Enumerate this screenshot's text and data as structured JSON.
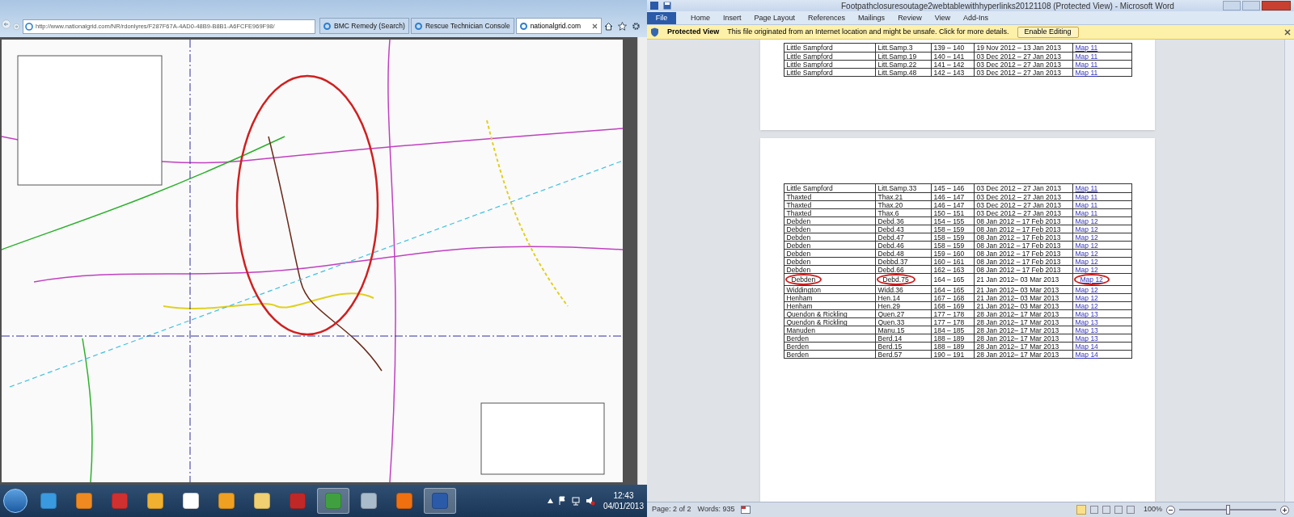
{
  "browser": {
    "address": "http://www.nationalgrid.com/NR/rdonlyres/F287F67A-4AD0-48B9-B8B1-A6FCFE969F98/",
    "tabs": [
      {
        "label": "BMC Remedy (Search)",
        "selected": false
      },
      {
        "label": "Rescue Technician Console",
        "selected": false
      },
      {
        "label": "nationalgrid.com",
        "selected": true
      }
    ]
  },
  "word": {
    "title": "Footpathclosuresoutage2webtablewithhyperlinks20121108 (Protected View)  -  Microsoft Word",
    "ribbon_tabs": [
      {
        "label": "File",
        "kind": "backstage"
      },
      {
        "label": "Home",
        "kind": "tab"
      },
      {
        "label": "Insert",
        "kind": "tab"
      },
      {
        "label": "Page Layout",
        "kind": "tab"
      },
      {
        "label": "References",
        "kind": "tab"
      },
      {
        "label": "Mailings",
        "kind": "tab"
      },
      {
        "label": "Review",
        "kind": "tab"
      },
      {
        "label": "View",
        "kind": "tab"
      },
      {
        "label": "Add-Ins",
        "kind": "tab"
      }
    ],
    "protected_view": {
      "title": "Protected View",
      "message": "This file originated from an Internet location and might be unsafe. Click for more details.",
      "button": "Enable Editing"
    },
    "pages": [
      {
        "rows": [
          {
            "cells": [
              "Little Sampford",
              "Litt.Samp.3",
              "139 – 140",
              "19 Nov 2012 – 13 Jan 2013",
              "Map 11"
            ],
            "circled": false
          },
          {
            "cells": [
              "Little Sampford",
              "Litt.Samp.19",
              "140 – 141",
              "03  Dec 2012 – 27 Jan 2013",
              "Map 11"
            ],
            "circled": false
          },
          {
            "cells": [
              "Little Sampford",
              "Litt.Samp.22",
              "141 – 142",
              "03  Dec 2012 – 27 Jan 2013",
              "Map 11"
            ],
            "circled": false
          },
          {
            "cells": [
              "Little Sampford",
              "Litt.Samp.48",
              "142 – 143",
              "03  Dec 2012 – 27 Jan 2013",
              "Map 11"
            ],
            "circled": false
          }
        ]
      },
      {
        "rows": [
          {
            "cells": [
              "Little Sampford",
              "Litt.Samp.33",
              "145 – 146",
              "03 Dec 2012 – 27 Jan 2013",
              "Map 11"
            ],
            "circled": false
          },
          {
            "cells": [
              "Thaxted",
              "Thax.21",
              "146 – 147",
              "03 Dec 2012 – 27 Jan 2013",
              "Map 11"
            ],
            "circled": false
          },
          {
            "cells": [
              "Thaxted",
              "Thax.20",
              "146 – 147",
              "03 Dec 2012 – 27 Jan 2013",
              "Map 11"
            ],
            "circled": false
          },
          {
            "cells": [
              "Thaxted",
              "Thax.6",
              "150 – 151",
              "03 Dec 2012 – 27 Jan 2013",
              "Map 11"
            ],
            "circled": false
          },
          {
            "cells": [
              "Debden",
              "Debd.36",
              "154 – 155",
              "08 Jan 2012 – 17 Feb 2013",
              "Map 12"
            ],
            "circled": false
          },
          {
            "cells": [
              "Debden",
              "Debd.43",
              "158 – 159",
              "08 Jan 2012 – 17 Feb 2013",
              "Map 12"
            ],
            "circled": false
          },
          {
            "cells": [
              "Debden",
              "Debd.47",
              "158 – 159",
              "08 Jan 2012 – 17 Feb 2013",
              "Map 12"
            ],
            "circled": false
          },
          {
            "cells": [
              "Debden",
              "Debd.46",
              "158 – 159",
              "08 Jan 2012 – 17 Feb 2013",
              "Map 12"
            ],
            "circled": false
          },
          {
            "cells": [
              "Debden",
              "Debd.48",
              "159 – 160",
              "08 Jan 2012 – 17 Feb 2013",
              "Map 12"
            ],
            "circled": false
          },
          {
            "cells": [
              "Debden",
              "Debbd.37",
              "160 – 161",
              "08 Jan 2012 – 17 Feb 2013",
              "Map 12"
            ],
            "circled": false
          },
          {
            "cells": [
              "Debden",
              "Debd.66",
              "162 – 163",
              "08 Jan 2012 – 17 Feb 2013",
              "Map 12"
            ],
            "circled": false
          },
          {
            "cells": [
              "Debden",
              "Debd.75",
              "164 – 165",
              "21 Jan 2012– 03 Mar 2013",
              "Map 12"
            ],
            "circled": true
          },
          {
            "cells": [
              "Widdington",
              "Widd.36",
              "164 – 165",
              "21 Jan 2012– 03 Mar 2013",
              "Map 12"
            ],
            "circled": false
          },
          {
            "cells": [
              "Henham",
              "Hen.14",
              "167 – 168",
              "21 Jan 2012– 03 Mar 2013",
              "Map 12"
            ],
            "circled": false
          },
          {
            "cells": [
              "Henham",
              "Hen.29",
              "168 – 169",
              "21 Jan 2012– 03 Mar 2013",
              "Map 12"
            ],
            "circled": false
          },
          {
            "cells": [
              "Quendon & Rickling",
              "Quen.27",
              "177 – 178",
              "28 Jan 2012– 17 Mar 2013",
              "Map 13"
            ],
            "circled": false
          },
          {
            "cells": [
              "Quendon & Rickling",
              "Quen.33",
              "177 – 178",
              "28 Jan 2012– 17 Mar 2013",
              "Map 13"
            ],
            "circled": false
          },
          {
            "cells": [
              "Manuden",
              "Manu.15",
              "184 – 185",
              "28 Jan 2012– 17 Mar 2013",
              "Map 13"
            ],
            "circled": false
          },
          {
            "cells": [
              "Berden",
              "Berd.14",
              "188 – 189",
              "28 Jan 2012– 17 Mar 2013",
              "Map 13"
            ],
            "circled": false
          },
          {
            "cells": [
              "Berden",
              "Berd.15",
              "188 – 189",
              "28 Jan 2012– 17 Mar 2013",
              "Map 14"
            ],
            "circled": false
          },
          {
            "cells": [
              "Berden",
              "Berd.57",
              "190 – 191",
              "28 Jan 2012– 17 Mar 2013",
              "Map 14"
            ],
            "circled": false
          }
        ]
      }
    ],
    "status_bar": {
      "page": "Page: 2 of 2",
      "words": "Words: 935",
      "zoom": "100%",
      "zoom_slider": {
        "level": 0.5
      }
    }
  },
  "taskbar": {
    "apps": [
      {
        "kind": "browser",
        "selected": false
      },
      {
        "kind": "media",
        "selected": false
      },
      {
        "kind": "toolbox",
        "selected": false
      },
      {
        "kind": "folder",
        "selected": false
      },
      {
        "kind": "vnc",
        "selected": false
      },
      {
        "kind": "mail",
        "selected": false
      },
      {
        "kind": "explorer",
        "selected": false
      },
      {
        "kind": "pdf",
        "selected": false
      },
      {
        "kind": "chrome",
        "selected": true
      },
      {
        "kind": "network",
        "selected": false
      },
      {
        "kind": "flame",
        "selected": false
      },
      {
        "kind": "word",
        "selected": true
      }
    ],
    "time": "12:43",
    "date": "04/01/2013"
  }
}
